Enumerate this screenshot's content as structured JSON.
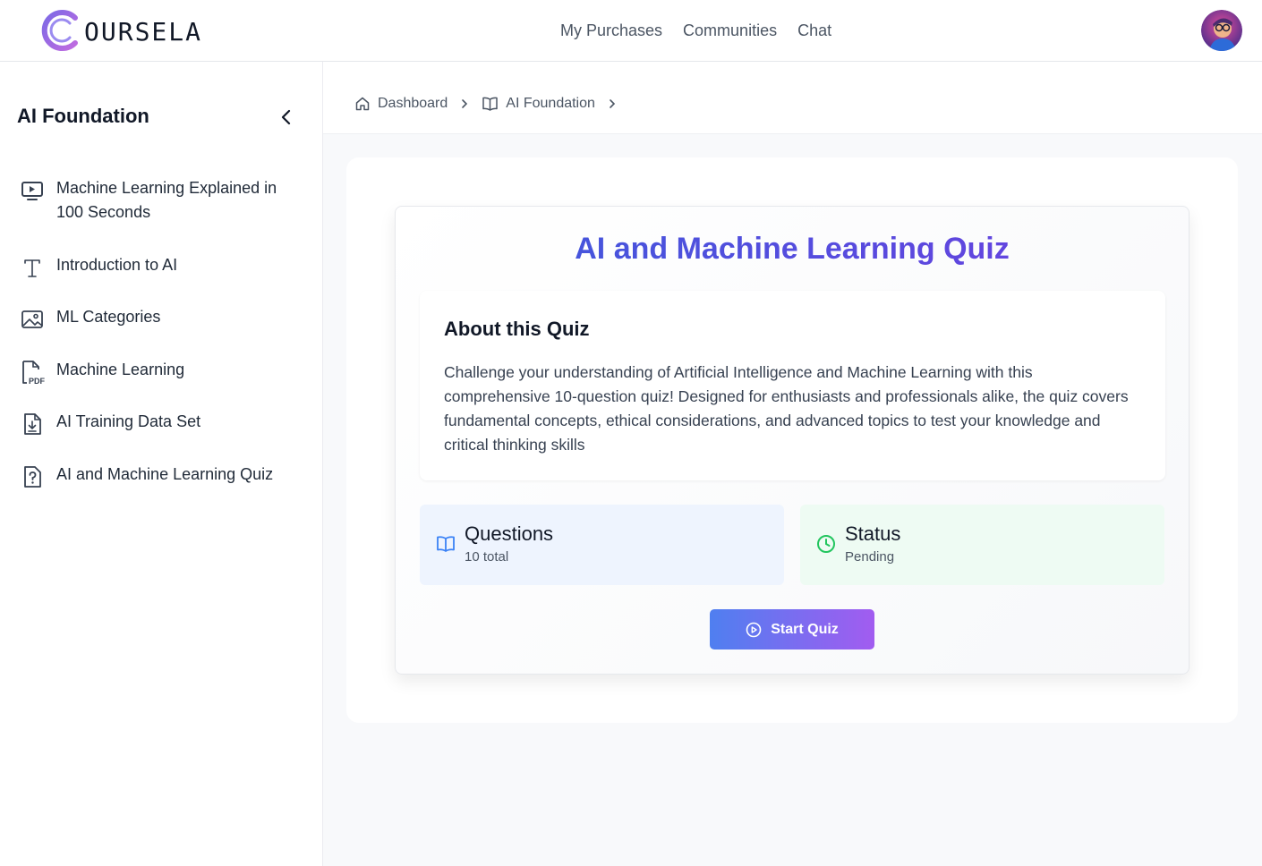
{
  "brand": {
    "logo_text": "OURSELA",
    "logo_letter": "C"
  },
  "nav": {
    "items": [
      {
        "label": "My Purchases"
      },
      {
        "label": "Communities"
      },
      {
        "label": "Chat"
      }
    ]
  },
  "user": {
    "avatar_icon": "avatar-icon"
  },
  "sidebar": {
    "title": "AI Foundation",
    "items": [
      {
        "label": "Machine Learning Explained in 100 Seconds",
        "icon": "video-icon"
      },
      {
        "label": "Introduction to AI",
        "icon": "text-icon"
      },
      {
        "label": "ML Categories",
        "icon": "image-icon"
      },
      {
        "label": "Machine Learning",
        "icon": "pdf-icon"
      },
      {
        "label": "AI Training Data Set",
        "icon": "file-download-icon"
      },
      {
        "label": "AI and Machine Learning Quiz",
        "icon": "quiz-icon"
      }
    ]
  },
  "breadcrumb": [
    {
      "label": "Dashboard",
      "icon": "home-icon"
    },
    {
      "label": "AI Foundation",
      "icon": "book-icon"
    }
  ],
  "quiz": {
    "title": "AI and Machine Learning Quiz",
    "about_heading": "About this Quiz",
    "about_text": "Challenge your understanding of Artificial Intelligence and Machine Learning with this comprehensive 10-question quiz! Designed for enthusiasts and professionals alike, the quiz covers fundamental concepts, ethical considerations, and advanced topics to test your knowledge and critical thinking skills",
    "questions_label": "Questions",
    "questions_value": "10 total",
    "status_label": "Status",
    "status_value": "Pending",
    "start_label": "Start Quiz"
  },
  "colors": {
    "title_gradient": [
      "#3b5bdb",
      "#6d3fe0"
    ],
    "button_gradient": [
      "#4f7ff0",
      "#a25cf0"
    ],
    "questions_bg": "#eef4fe",
    "status_bg": "#eefbf3",
    "status_icon": "#22c55e",
    "questions_icon": "#3b82f6"
  }
}
